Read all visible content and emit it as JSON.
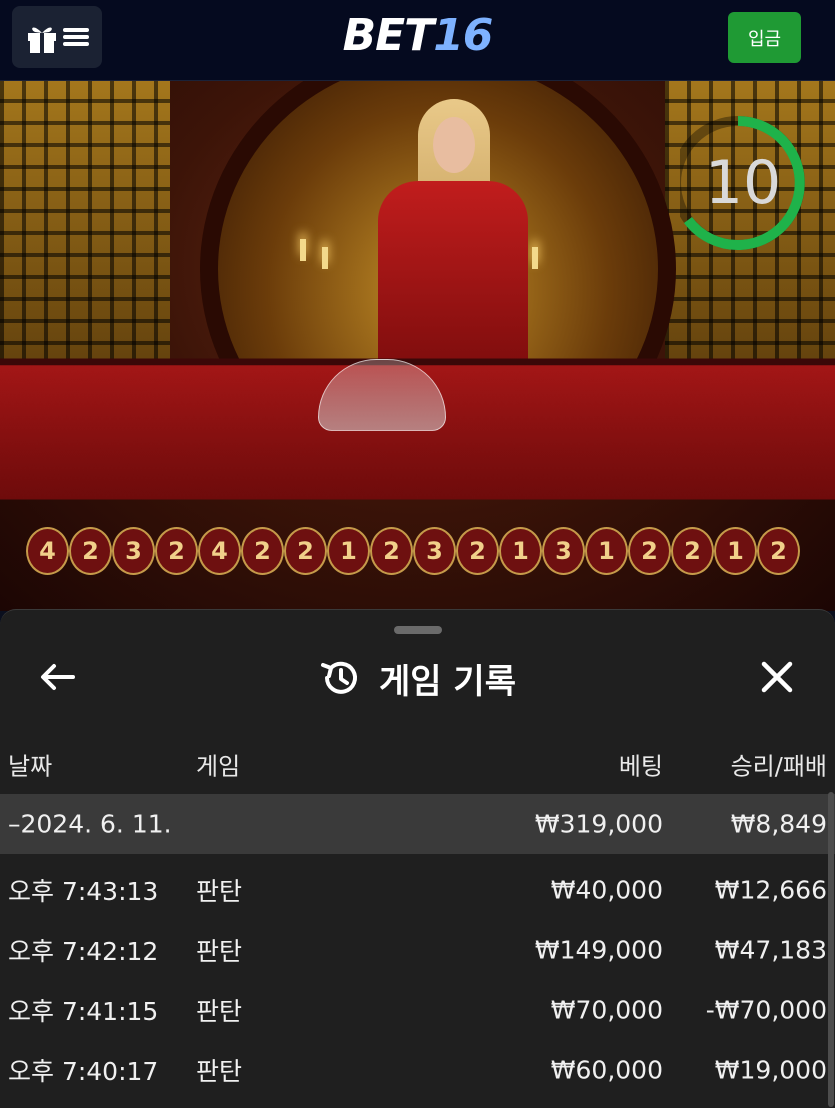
{
  "header": {
    "logo_part1": "BET",
    "logo_part2": "16",
    "deposit_label": "입금"
  },
  "video": {
    "timer_value": "10",
    "bead_road": [
      "4",
      "2",
      "3",
      "2",
      "4",
      "2",
      "2",
      "1",
      "2",
      "3",
      "2",
      "1",
      "3",
      "1",
      "2",
      "2",
      "1",
      "2"
    ]
  },
  "history": {
    "title": "게임 기록",
    "columns": {
      "date": "날짜",
      "game": "게임",
      "bet": "베팅",
      "winloss": "승리/패배"
    },
    "summary": {
      "date": "–2024. 6. 11.",
      "game": "",
      "bet": "₩319,000",
      "winloss": "₩8,849"
    },
    "rows": [
      {
        "time": "오후 7:43:13",
        "game": "판탄",
        "bet": "₩40,000",
        "winloss": "₩12,666"
      },
      {
        "time": "오후 7:42:12",
        "game": "판탄",
        "bet": "₩149,000",
        "winloss": "₩47,183"
      },
      {
        "time": "오후 7:41:15",
        "game": "판탄",
        "bet": "₩70,000",
        "winloss": "-₩70,000"
      },
      {
        "time": "오후 7:40:17",
        "game": "판탄",
        "bet": "₩60,000",
        "winloss": "₩19,000"
      }
    ]
  },
  "colors": {
    "deposit_button": "#1f9a34",
    "logo_accent": "#7eb2ff",
    "timer_ring": "#1fb24a",
    "sheet_bg": "#1f1f1f"
  }
}
